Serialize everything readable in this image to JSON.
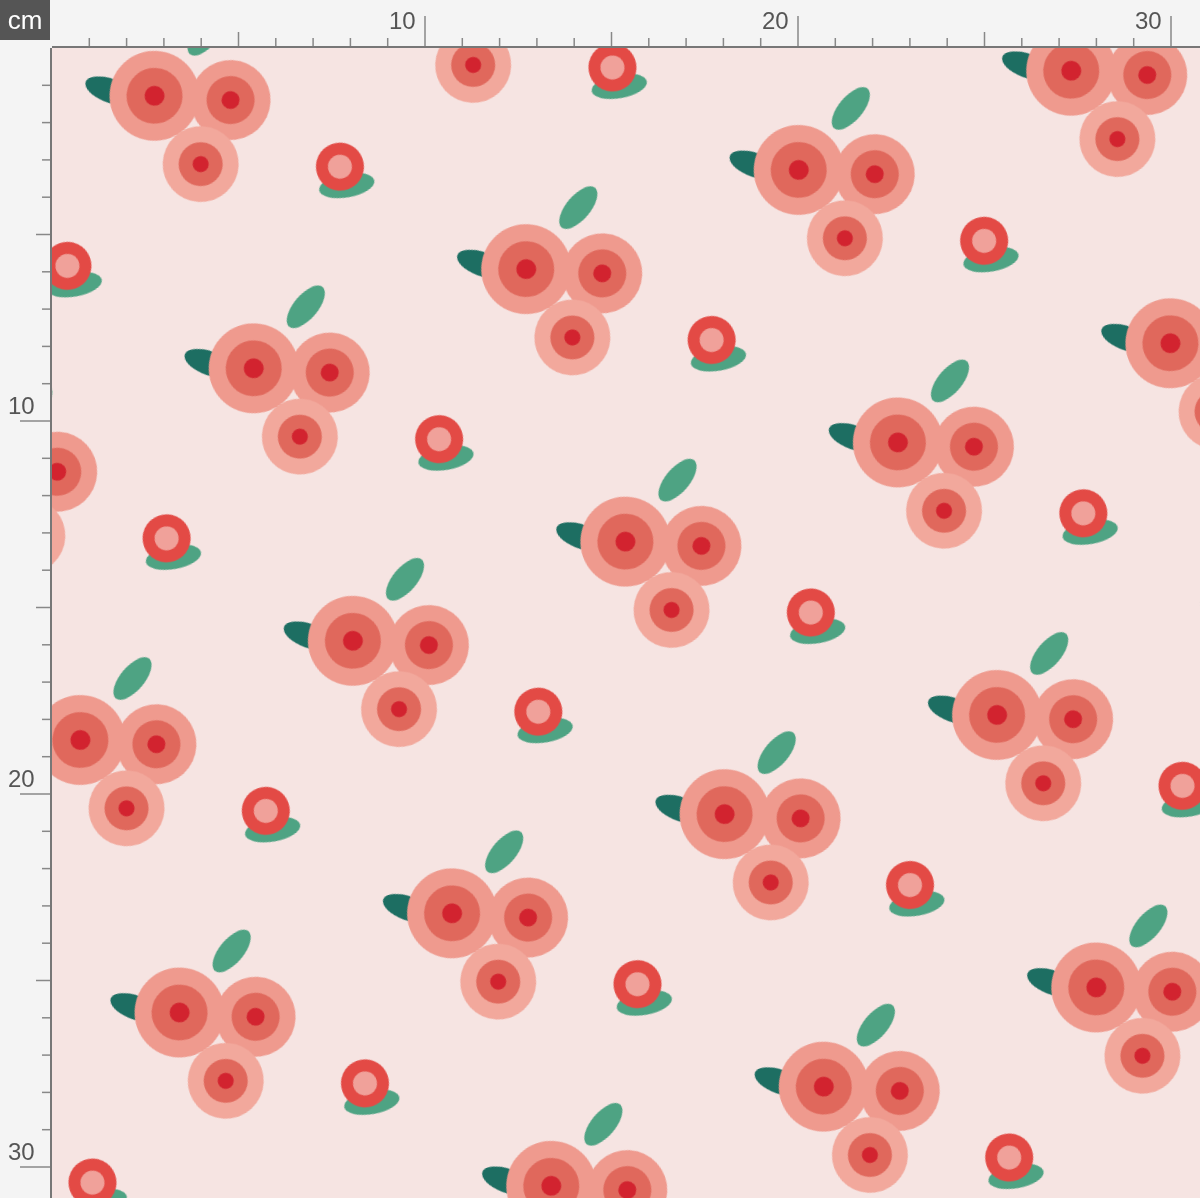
{
  "unit_label": "cm",
  "top_ruler": {
    "labels": [
      "10",
      "20",
      "30"
    ]
  },
  "left_ruler": {
    "labels": [
      "10",
      "20",
      "30"
    ]
  }
}
